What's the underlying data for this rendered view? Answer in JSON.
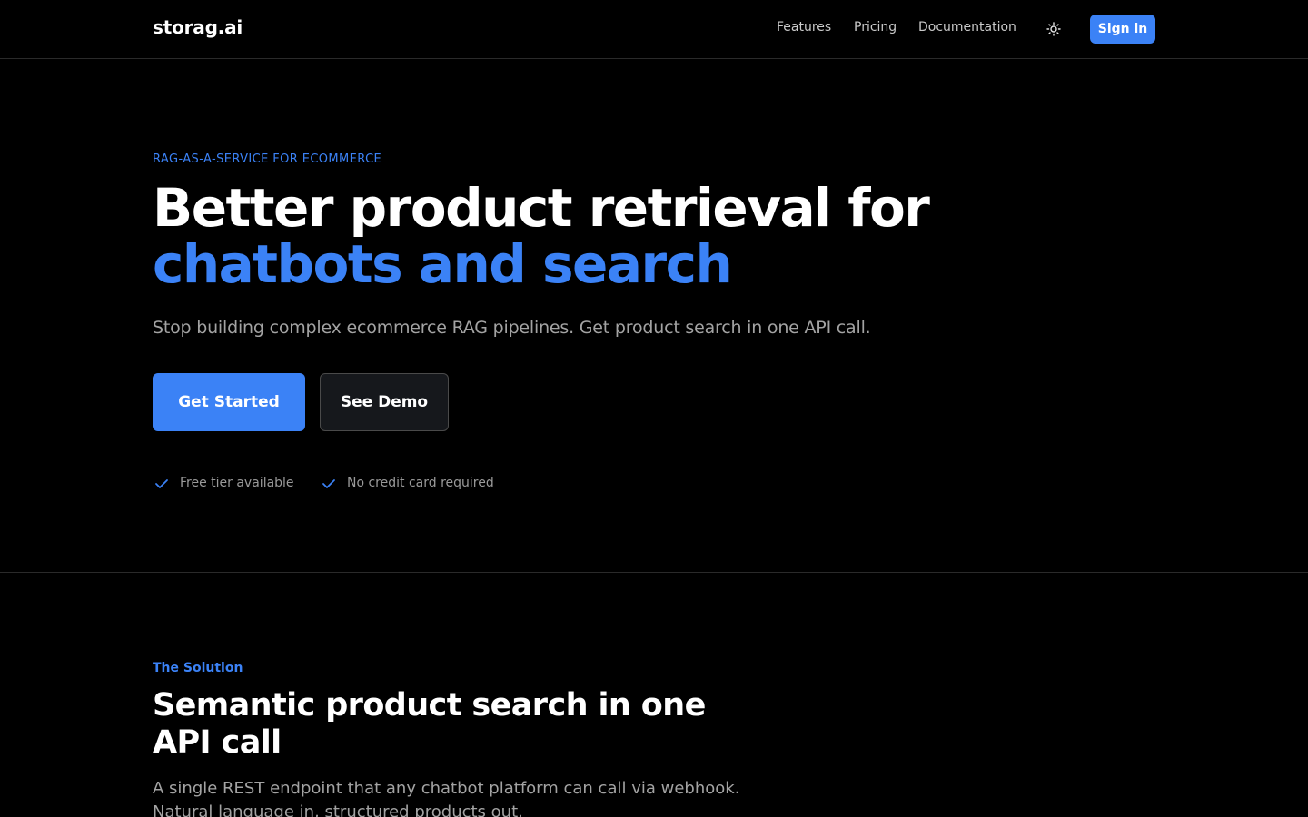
{
  "header": {
    "logo": "storag.ai",
    "nav": [
      "Features",
      "Pricing",
      "Documentation"
    ],
    "theme_icon": "sun-icon",
    "signin_label": "Sign in"
  },
  "hero": {
    "eyebrow": "RAG-AS-A-SERVICE FOR ECOMMERCE",
    "title_line1": "Better product retrieval for",
    "title_line2": "chatbots and search",
    "subtitle": "Stop building complex ecommerce RAG pipelines. Get product search in one API call.",
    "primary_cta": "Get Started",
    "secondary_cta": "See Demo",
    "perks": [
      "Free tier available",
      "No credit card required"
    ],
    "perk_icon": "check-icon"
  },
  "solution": {
    "eyebrow": "The Solution",
    "title": "Semantic product search in one API call",
    "description": "A single REST endpoint that any chatbot platform can call via webhook. Natural language in, structured products out."
  },
  "colors": {
    "accent": "#3b82f6",
    "background": "#000000",
    "muted_text": "#a3a3a3",
    "border": "#2a2a2a"
  }
}
